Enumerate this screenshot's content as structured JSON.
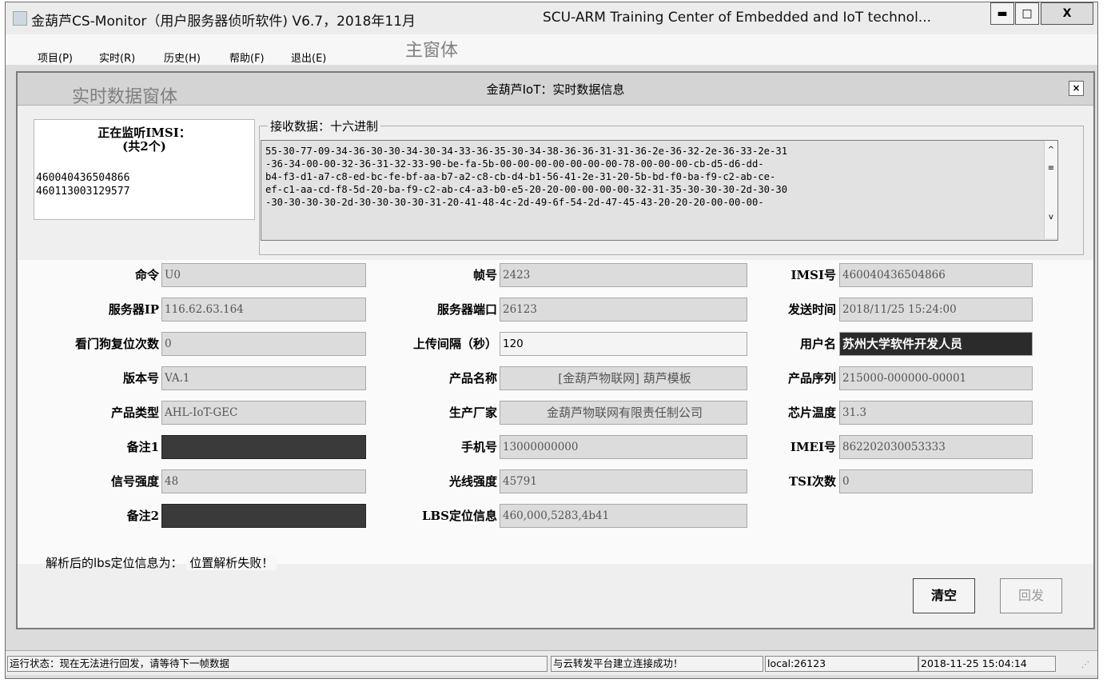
{
  "window": {
    "title": "金葫芦CS-Monitor（用户服务器侦听软件) V6.7，2018年11月",
    "title_right": "SCU-ARM Training Center of Embedded and IoT technol...",
    "min": "▬",
    "max": "□",
    "close": "X"
  },
  "menu": [
    "项目(P)",
    "实时(R)",
    "历史(H)",
    "帮助(F)",
    "退出(E)"
  ],
  "annotations": {
    "main": "主窗体",
    "realtime": "实时数据窗体"
  },
  "child": {
    "title": "金葫芦IoT：实时数据信息",
    "close": "×"
  },
  "imsi_panel": {
    "heading": "正在监听IMSI：",
    "count": "(共2个)",
    "items": [
      "460040436504866",
      "460113003129577"
    ]
  },
  "recv": {
    "label": "接收数据：十六进制",
    "lines": [
      "55-30-77-09-34-36-30-30-34-30-34-33-36-35-30-34-38-36-36-31-31-36-2e-36-32-2e-36-33-2e-31",
      "-36-34-00-00-32-36-31-32-33-90-be-fa-5b-00-00-00-00-00-00-00-78-00-00-00-cb-d5-d6-dd-",
      "b4-f3-d1-a7-c8-ed-bc-fe-bf-aa-b7-a2-c8-cb-d4-b1-56-41-2e-31-20-5b-bd-f0-ba-f9-c2-ab-ce-",
      "ef-c1-aa-cd-f8-5d-20-ba-f9-c2-ab-c4-a3-b0-e5-20-20-00-00-00-00-32-31-35-30-30-30-2d-30-30",
      "-30-30-30-30-2d-30-30-30-30-31-20-41-48-4c-2d-49-6f-54-2d-47-45-43-20-20-20-00-00-00-"
    ],
    "scroll_up": "^",
    "scroll_mid": "≡",
    "scroll_down": "v"
  },
  "fields": {
    "col1": [
      {
        "label": "命令",
        "value": "U0"
      },
      {
        "label": "服务器IP",
        "value": "116.62.63.164"
      },
      {
        "label": "看门狗复位次数",
        "value": "0"
      },
      {
        "label": "版本号",
        "value": "VA.1"
      },
      {
        "label": "产品类型",
        "value": "AHL-IoT-GEC"
      },
      {
        "label": "备注1",
        "value": ""
      },
      {
        "label": "信号强度",
        "value": "48"
      },
      {
        "label": "备注2",
        "value": ""
      }
    ],
    "col2": [
      {
        "label": "帧号",
        "value": "2423"
      },
      {
        "label": "服务器端口",
        "value": "26123"
      },
      {
        "label": "上传间隔（秒）",
        "value": "120"
      },
      {
        "label": "产品名称",
        "value": "[金葫芦物联网] 葫芦模板"
      },
      {
        "label": "生产厂家",
        "value": "金葫芦物联网有限责任制公司"
      },
      {
        "label": "手机号",
        "value": "13000000000"
      },
      {
        "label": "光线强度",
        "value": "45791"
      },
      {
        "label": "LBS定位信息",
        "value": "460,000,5283,4b41"
      }
    ],
    "col3": [
      {
        "label": "IMSI号",
        "value": "460040436504866"
      },
      {
        "label": "发送时间",
        "value": "2018/11/25 15:24:00"
      },
      {
        "label": "用户名",
        "value": "苏州大学软件开发人员"
      },
      {
        "label": "产品序列",
        "value": "215000-000000-00001"
      },
      {
        "label": "芯片温度",
        "value": "31.3"
      },
      {
        "label": "IMEI号",
        "value": "862202030053333"
      },
      {
        "label": "TSI次数",
        "value": "0"
      }
    ]
  },
  "lbs_result": {
    "label": "解析后的lbs定位信息为：",
    "value": "位置解析失败！"
  },
  "buttons": {
    "clear": "清空",
    "reply": "回发"
  },
  "status": {
    "run": "运行状态：现在无法进行回发，请等待下一帧数据",
    "cloud": "与云转发平台建立连接成功！",
    "local": "local:26123",
    "time": "2018-11-25 15:04:14"
  }
}
